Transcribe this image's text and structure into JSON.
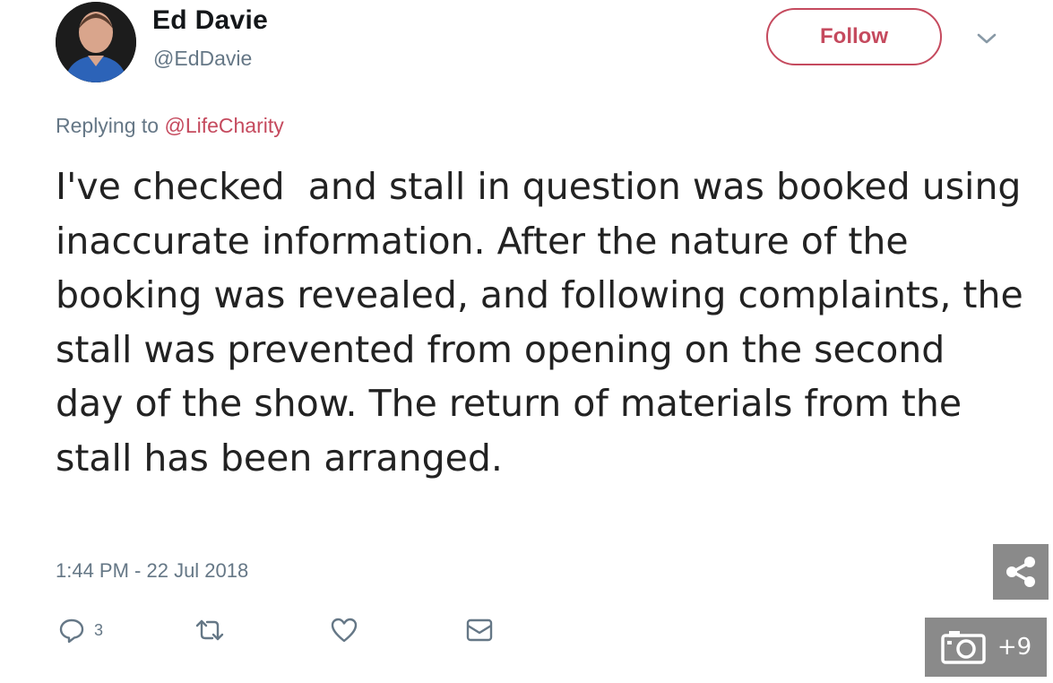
{
  "author": {
    "name": "Ed Davie",
    "handle": "@EdDavie",
    "avatar_icon": "user-avatar"
  },
  "follow_button": {
    "label": "Follow",
    "color": "#c54a5e"
  },
  "menu_icon": "chevron-down-icon",
  "reply": {
    "prefix": "Replying to",
    "mention": "@LifeCharity"
  },
  "tweet_text": "I've checked  and stall in question was booked using inaccurate information. After the nature of the booking was revealed, and following complaints, the stall was prevented from opening on the second day of the show. The return of materials from the stall has been arranged.",
  "timestamp": "1:44 PM - 22 Jul 2018",
  "actions": {
    "reply": {
      "icon": "reply-icon",
      "count": "3"
    },
    "retweet": {
      "icon": "retweet-icon"
    },
    "like": {
      "icon": "heart-icon"
    },
    "message": {
      "icon": "envelope-icon"
    }
  },
  "overlay": {
    "share_icon": "share-icon",
    "gallery_icon": "camera-icon",
    "gallery_count": "+9"
  }
}
